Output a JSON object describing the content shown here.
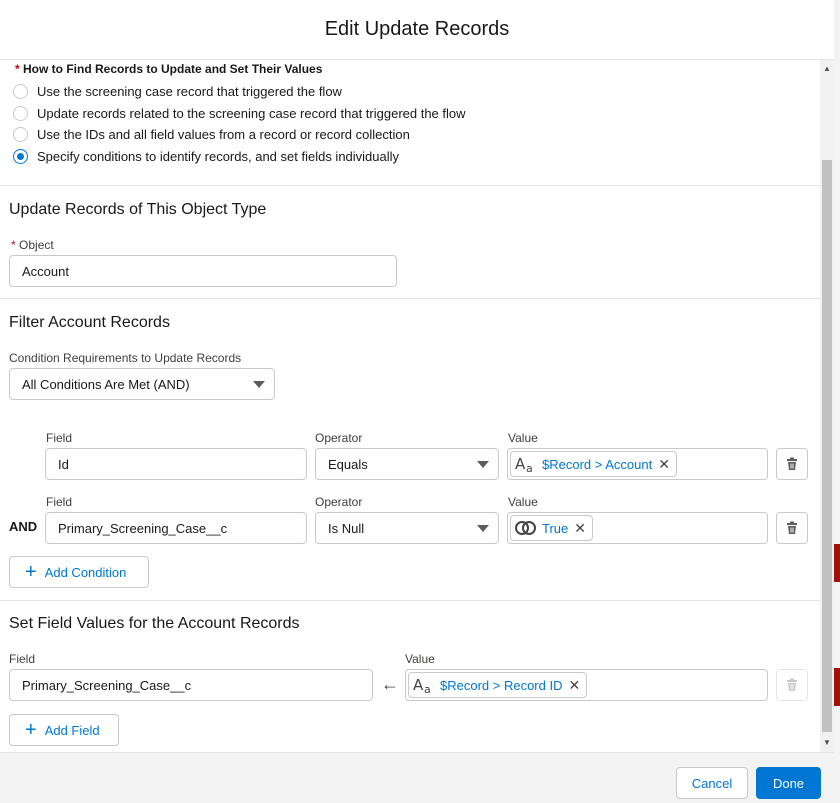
{
  "modal": {
    "title": "Edit Update Records",
    "cancel_label": "Cancel",
    "done_label": "Done"
  },
  "find_records": {
    "required_mark": "*",
    "label": "How to Find Records to Update and Set Their Values",
    "options": [
      {
        "label": "Use the screening case record that triggered the flow",
        "checked": false
      },
      {
        "label": "Update records related to the screening case record that triggered the flow",
        "checked": false
      },
      {
        "label": "Use the IDs and all field values from a record or record collection",
        "checked": false
      },
      {
        "label": "Specify conditions to identify records, and set fields individually",
        "checked": true
      }
    ]
  },
  "object_section": {
    "title": "Update Records of This Object Type",
    "required_mark": "*",
    "object_label": "Object",
    "object_value": "Account"
  },
  "filter_section": {
    "title": "Filter Account Records",
    "condition_req_label": "Condition Requirements to Update Records",
    "condition_req_value": "All Conditions Are Met (AND)",
    "field_label": "Field",
    "operator_label": "Operator",
    "value_label": "Value",
    "and_label": "AND",
    "conditions": [
      {
        "field": "Id",
        "operator": "Equals",
        "value": "$Record > Account",
        "value_icon": "text-type-icon"
      },
      {
        "field": "Primary_Screening_Case__c",
        "operator": "Is Null",
        "value": "True",
        "value_icon": "boolean-icon"
      }
    ],
    "add_condition_label": "Add Condition"
  },
  "set_fields_section": {
    "title": "Set Field Values for the Account Records",
    "field_label": "Field",
    "value_label": "Value",
    "field_value": "Primary_Screening_Case__c",
    "value": "$Record > Record ID",
    "value_icon": "text-type-icon",
    "add_field_label": "Add Field"
  },
  "colors": {
    "brand": "#0176d3",
    "required": "#ba0517",
    "border": "#c9c9c9"
  }
}
